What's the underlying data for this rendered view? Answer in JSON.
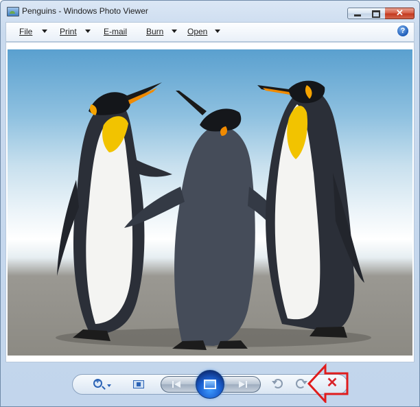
{
  "window": {
    "title": "Penguins - Windows Photo Viewer",
    "close_glyph": "✕"
  },
  "menu": {
    "items": [
      {
        "label": "File"
      },
      {
        "label": "Print"
      },
      {
        "label": "E-mail"
      },
      {
        "label": "Burn"
      },
      {
        "label": "Open"
      }
    ],
    "help_glyph": "?"
  },
  "toolbar": {
    "delete_glyph": "✕"
  },
  "icons": {
    "app": "photo-viewer-icon",
    "help": "help-icon",
    "zoom": "magnifier-plus-icon",
    "fit": "actual-size-icon",
    "previous": "previous-icon",
    "slideshow": "slideshow-icon",
    "next": "next-icon",
    "rotate_ccw": "rotate-counterclockwise-icon",
    "rotate_cw": "rotate-clockwise-icon",
    "delete": "delete-icon"
  },
  "colors": {
    "window_chrome": "#c9daee",
    "delete_red": "#d8242a",
    "annotation_red": "#e01c1c"
  }
}
